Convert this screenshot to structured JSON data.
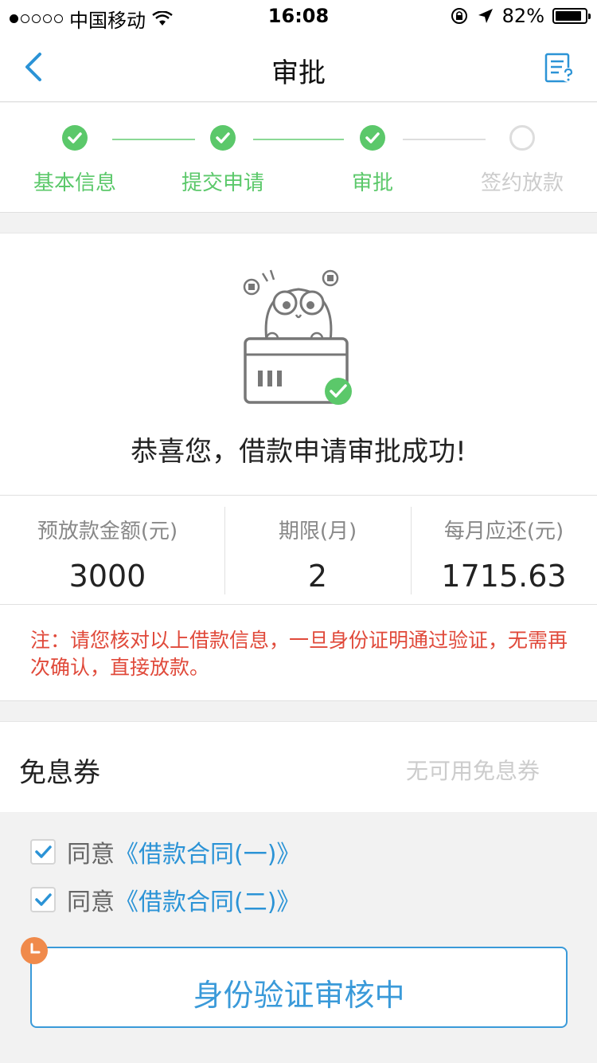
{
  "status_bar": {
    "carrier": "中国移动",
    "time": "16:08",
    "battery": "82%"
  },
  "nav": {
    "title": "审批"
  },
  "steps": [
    {
      "label": "基本信息",
      "done": true
    },
    {
      "label": "提交申请",
      "done": true
    },
    {
      "label": "审批",
      "done": true
    },
    {
      "label": "签约放款",
      "done": false
    }
  ],
  "result": {
    "message": "恭喜您，借款申请审批成功!"
  },
  "stats": [
    {
      "label": "预放款金额(元)",
      "value": "3000"
    },
    {
      "label": "期限(月)",
      "value": "2"
    },
    {
      "label": "每月应还(元)",
      "value": "1715.63"
    }
  ],
  "note": "注：请您核对以上借款信息，一旦身份证明通过验证，无需再次确认，直接放款。",
  "coupon": {
    "label": "免息券",
    "value": "无可用免息券"
  },
  "agreements": [
    {
      "prefix": "同意",
      "link": "《借款合同(一)》",
      "checked": true
    },
    {
      "prefix": "同意",
      "link": "《借款合同(二)》",
      "checked": true
    }
  ],
  "action": {
    "label": "身份验证审核中"
  },
  "colors": {
    "green": "#5bc86a",
    "blue": "#3a9ad9",
    "red": "#e04a3b",
    "orange": "#f08a4b"
  },
  "icons": [
    "back-chevron-icon",
    "help-document-icon",
    "check-icon",
    "wifi-icon",
    "location-arrow-icon",
    "lock-rotation-icon",
    "clock-icon"
  ]
}
